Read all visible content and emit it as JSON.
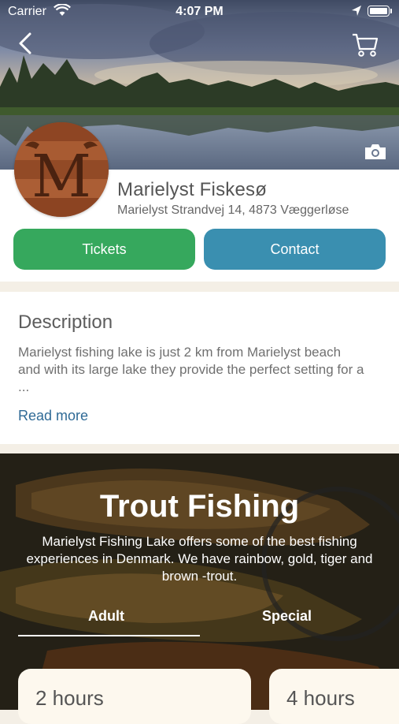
{
  "status_bar": {
    "carrier": "Carrier",
    "time": "4:07 PM"
  },
  "header": {
    "icons": [
      "back-chevron-icon",
      "cart-icon",
      "camera-icon"
    ]
  },
  "venue": {
    "logo_letter": "M",
    "name": "Marielyst Fiskesø",
    "address": "Marielyst Strandvej 14, 4873 Væggerløse"
  },
  "actions": {
    "tickets_label": "Tickets",
    "contact_label": "Contact"
  },
  "description": {
    "title": "Description",
    "text": "Marielyst fishing lake is just 2 km from Marielyst beach and with its large lake they provide the perfect setting for a ...",
    "read_more": "Read more"
  },
  "trout": {
    "title": "Trout Fishing",
    "text": "Marielyst Fishing Lake offers some of the best fishing experiences in Denmark. We have rainbow, gold, tiger and brown -trout.",
    "tabs": [
      "Adult",
      "Special"
    ],
    "selected_tab": "Adult",
    "cards": [
      "2 hours",
      "4 hours"
    ]
  },
  "colors": {
    "tickets": "#36a85d",
    "contact": "#3a8fb0",
    "link": "#2f6a96"
  }
}
